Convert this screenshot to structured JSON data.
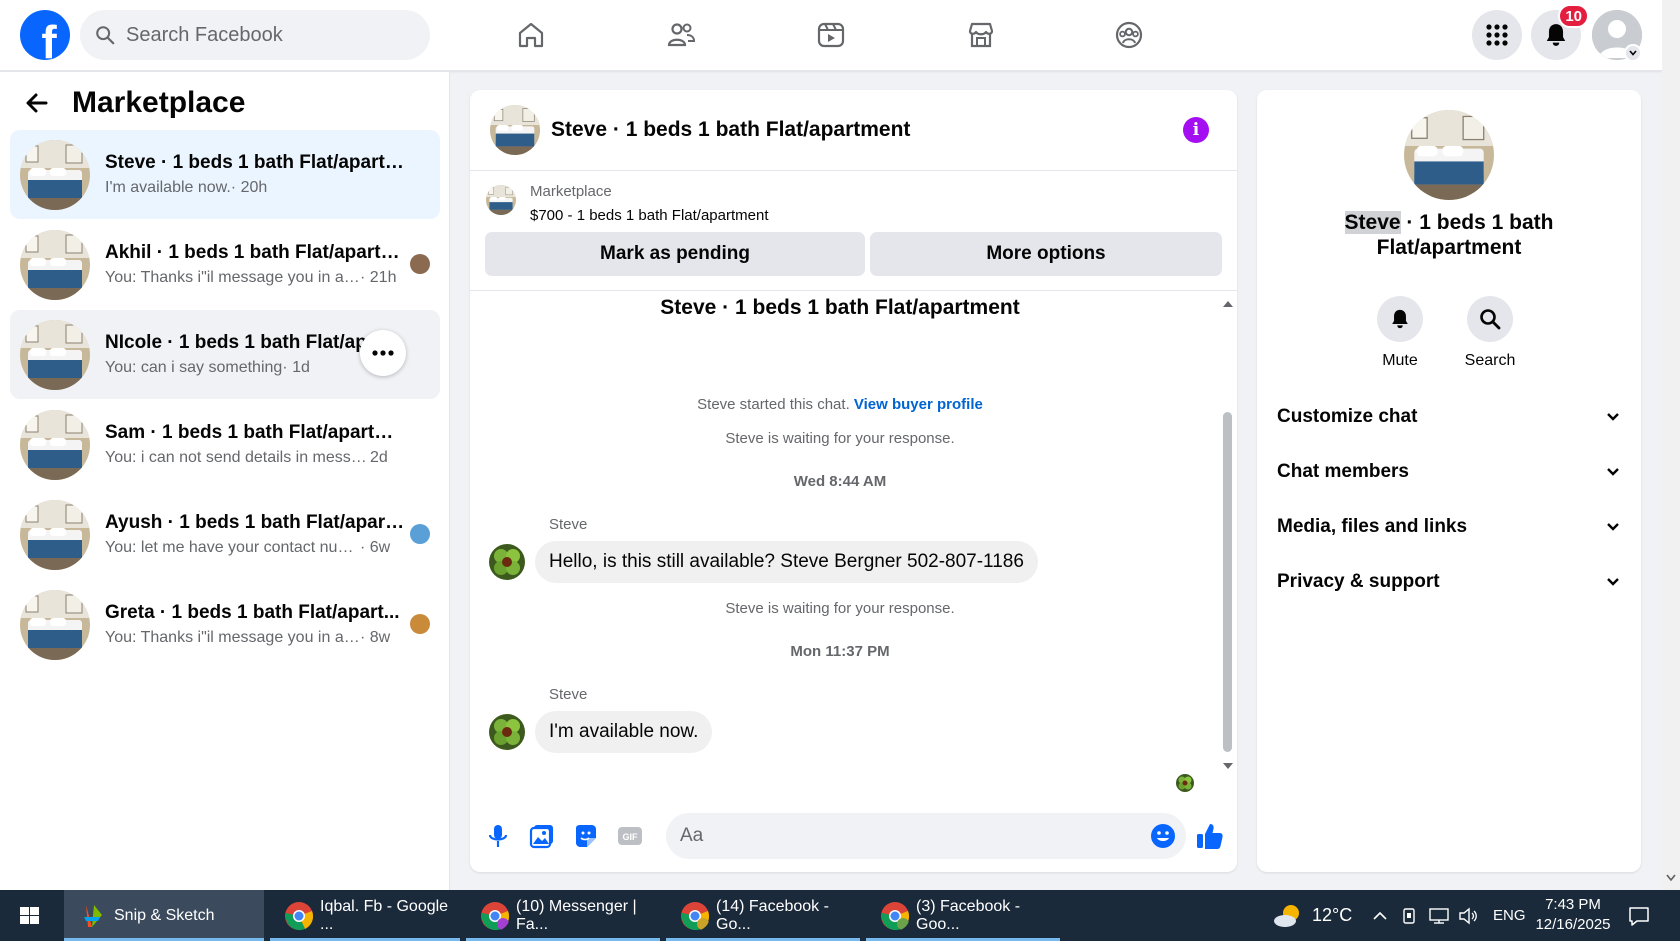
{
  "search": {
    "placeholder": "Search Facebook"
  },
  "notifications": {
    "count": "10"
  },
  "sidebar": {
    "title": "Marketplace",
    "conversations": [
      {
        "name": "Steve · 1 beds 1 bath Flat/apartment",
        "snippet": "I'm available now.",
        "time": " · 20h"
      },
      {
        "name": "Akhil · 1 beds 1 bath Flat/apartm...",
        "snippet": "You: Thanks i\"il message you in a ...",
        "time": " · 21h"
      },
      {
        "name": "NIcole · 1 beds 1 bath Flat/apar...",
        "snippet": "You: can i say something",
        "time": " · 1d"
      },
      {
        "name": "Sam · 1 beds 1 bath Flat/apartment",
        "snippet": "You: i can not send details in messang...",
        "time": " 2d"
      },
      {
        "name": "Ayush · 1 beds 1 bath Flat/apart...",
        "snippet": "You: let me have your contact num...",
        "time": " · 6w"
      },
      {
        "name": "Greta · 1 beds 1 bath Flat/apart...",
        "snippet": "You: Thanks i\"il message you in a ...",
        "time": " · 8w"
      }
    ]
  },
  "chat": {
    "title": "Steve · 1 beds 1 bath Flat/apartment",
    "listing_label": "Marketplace",
    "listing_price": "$700 - 1 beds 1 bath Flat/apartment",
    "mark_pending": "Mark as pending",
    "more_options": "More options",
    "thread_title": "Steve · 1 beds 1 bath Flat/apartment",
    "started_text": "Steve started this chat.",
    "view_profile": "View buyer profile",
    "waiting_1": "Steve is waiting for your response.",
    "time_1": "Wed 8:44 AM",
    "sender_1": "Steve",
    "message_1": "Hello, is this still available?  Steve Bergner 502-807-1186",
    "waiting_2": "Steve is waiting for your response.",
    "time_2": "Mon 11:37 PM",
    "sender_2": "Steve",
    "message_2": "I'm available now.",
    "composer_placeholder": "Aa"
  },
  "details": {
    "title_highlight": "Steve",
    "title_rest": " · 1 beds 1 bath Flat/apartment",
    "mute": "Mute",
    "search": "Search",
    "sections": [
      "Customize chat",
      "Chat members",
      "Media, files and links",
      "Privacy & support"
    ]
  },
  "taskbar": {
    "apps": [
      "Snip & Sketch",
      "Iqbal. Fb - Google ...",
      "(10) Messenger | Fa...",
      "(14) Facebook - Go...",
      "(3) Facebook - Goo..."
    ],
    "temperature": "12°C",
    "language": "ENG",
    "time": "7:43 PM",
    "date": "12/16/2025"
  },
  "colors": {
    "brand": "#0866ff",
    "purple_info": "#a40ff2",
    "link": "#0064d1"
  }
}
